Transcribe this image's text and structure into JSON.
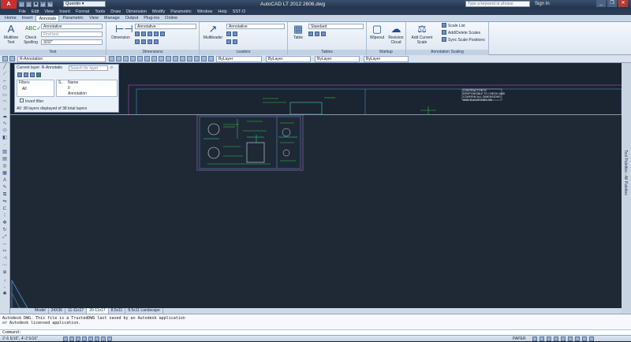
{
  "titlebar": {
    "workspace": "Quentin",
    "title": "AutoCAD LT 2012   2606.dwg",
    "search_placeholder": "Type a keyword or phrase",
    "signin": "Sign In",
    "minimize": "_",
    "restore": "❐",
    "close": "✕"
  },
  "menu": [
    "File",
    "Edit",
    "View",
    "Insert",
    "Format",
    "Tools",
    "Draw",
    "Dimension",
    "Modify",
    "Parametric",
    "Window",
    "Help",
    "SST-O"
  ],
  "tabs": [
    "Home",
    "Insert",
    "Annotate",
    "Parametric",
    "View",
    "Manage",
    "Output",
    "Plug-ins",
    "Online"
  ],
  "active_tab": "Annotate",
  "ribbon": {
    "text_panel": {
      "title": "Text",
      "multiline": "Multiline Text",
      "check": "Check Spelling",
      "style": "Annotative",
      "find_placeholder": "Find text",
      "height": "3/32\""
    },
    "dimensions_panel": {
      "title": "Dimensions",
      "button": "Dimension",
      "style": "Annotative"
    },
    "leaders_panel": {
      "title": "Leaders",
      "button": "Multileader",
      "style": "Annotative"
    },
    "tables_panel": {
      "title": "Tables",
      "button": "Table",
      "style": "Standard"
    },
    "markup_panel": {
      "title": "Markup",
      "wipeout": "Wipeout",
      "revcloud": "Revision Cloud"
    },
    "scaling_panel": {
      "title": "Annotation Scaling",
      "add_current": "Add Current Scale",
      "scale_list": "Scale List",
      "add_delete": "Add/Delete Scales",
      "sync": "Sync Scale Positions"
    }
  },
  "layer_props": {
    "layer": "R-Annotation",
    "color": "ByLayer",
    "linetype": "ByLayer",
    "lineweight": "ByLayer",
    "plotstyle": "ByLayer"
  },
  "layer_manager": {
    "current_label": "Current layer: R-Annotatio",
    "search_placeholder": "Search for layer",
    "filters_label": "Filters",
    "all_label": "All",
    "invert_label": "Invert filter",
    "status_col": "S..",
    "name_col": "Name",
    "row1": "0",
    "row2": "Annotation",
    "summary": "All: 38 layers displayed of 38 total layers"
  },
  "drawing_note": "CONTRACTOR IS RESPONSIBLE TO CHECK AND CONFIRM ALL DIMENSIONS AND ELEVATIONS ON DRAWINGS.",
  "layout_tabs": [
    "Model",
    "24X36",
    "11-11x17",
    "20-11x17",
    "8.5x11",
    "8.5x11 Landscape"
  ],
  "active_layout": "20-11x17",
  "command_history": [
    "Autodesk DWG.  This file is a TrustedDWG last saved by an Autodesk application",
    "or Autodesk licensed application."
  ],
  "command_prompt": "Command:",
  "status": {
    "coords": "2'-6 5/16\", 4'-2 5/16\"",
    "paper": "PAPER"
  },
  "right_palette": "Tool Palettes - All Palettes"
}
